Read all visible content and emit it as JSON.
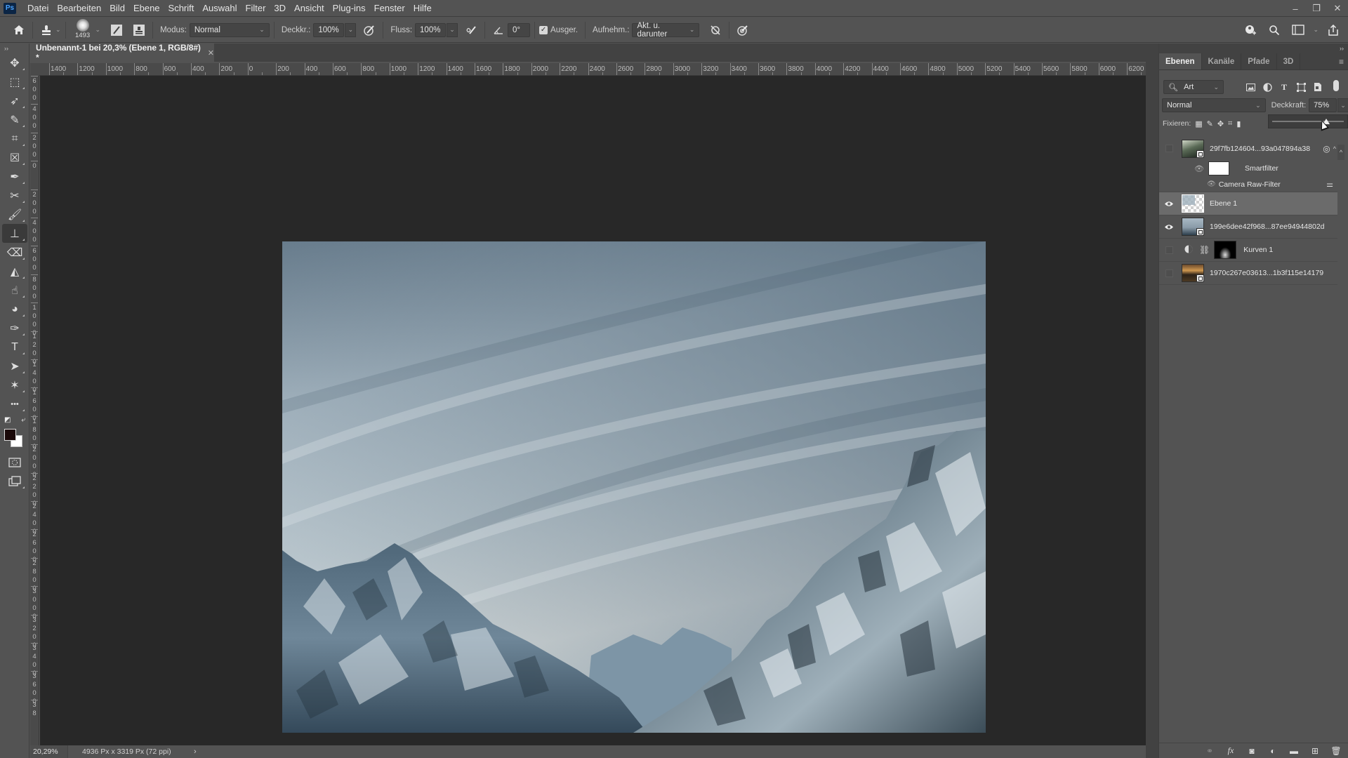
{
  "app": {
    "logo": "Ps",
    "name": "Adobe Photoshop"
  },
  "menu": [
    "Datei",
    "Bearbeiten",
    "Bild",
    "Ebene",
    "Schrift",
    "Auswahl",
    "Filter",
    "3D",
    "Ansicht",
    "Plug-ins",
    "Fenster",
    "Hilfe"
  ],
  "window_controls": {
    "minimize": "–",
    "restore": "❐",
    "close": "✕"
  },
  "options": {
    "brush_size": "1493",
    "mode_label": "Modus:",
    "mode_value": "Normal",
    "opacity_label": "Deckkr.:",
    "opacity_value": "100%",
    "flow_label": "Fluss:",
    "flow_value": "100%",
    "angle_value": "0°",
    "aligned_label": "Ausger.",
    "aligned_checked": true,
    "sample_label": "Aufnehm.:",
    "sample_value": "Akt. u. darunter"
  },
  "document": {
    "tab_title": "Unbenannt-1 bei 20,3% (Ebene 1, RGB/8#) *",
    "close": "✕"
  },
  "ruler": {
    "top_labels": [
      "1400",
      "1200",
      "1000",
      "800",
      "600",
      "400",
      "200",
      "0",
      "200",
      "400",
      "600",
      "800",
      "1000",
      "1200",
      "1400",
      "1600",
      "1800",
      "2000",
      "2200",
      "2400",
      "2600",
      "2800",
      "3000",
      "3200",
      "3400",
      "3600",
      "3800",
      "4000",
      "4200",
      "4400",
      "4600",
      "4800",
      "5000",
      "5200",
      "5400",
      "5600",
      "5800",
      "6000",
      "6200"
    ],
    "left_labels": [
      "600",
      "400",
      "200",
      "0",
      "200",
      "400",
      "600",
      "800",
      "1000",
      "1200",
      "1400",
      "1600",
      "1800",
      "2000",
      "2200",
      "2400",
      "2600",
      "2800",
      "3000",
      "3200",
      "3400",
      "3600",
      "38"
    ]
  },
  "status": {
    "zoom": "20,29%",
    "doc_size": "4936 Px x 3319 Px (72 ppi)",
    "arrow": "›"
  },
  "tools": [
    {
      "name": "move-tool",
      "glyph": "✥"
    },
    {
      "name": "marquee-tool",
      "glyph": "⬚"
    },
    {
      "name": "lasso-tool",
      "glyph": "➶"
    },
    {
      "name": "quick-selection-tool",
      "glyph": "✎"
    },
    {
      "name": "crop-tool",
      "glyph": "⌗"
    },
    {
      "name": "frame-tool",
      "glyph": "☒"
    },
    {
      "name": "eyedropper-tool",
      "glyph": "✒"
    },
    {
      "name": "healing-brush-tool",
      "glyph": "✂"
    },
    {
      "name": "brush-tool",
      "glyph": "🖌"
    },
    {
      "name": "clone-stamp-tool",
      "glyph": "⊥"
    },
    {
      "name": "eraser-tool",
      "glyph": "⌫"
    },
    {
      "name": "paint-bucket-tool",
      "glyph": "◭"
    },
    {
      "name": "smudge-tool",
      "glyph": "☝"
    },
    {
      "name": "dodge-tool",
      "glyph": "◕"
    },
    {
      "name": "pen-tool",
      "glyph": "✑"
    },
    {
      "name": "type-tool",
      "glyph": "T"
    },
    {
      "name": "path-selection-tool",
      "glyph": "➤"
    },
    {
      "name": "custom-shape-tool",
      "glyph": "✶"
    },
    {
      "name": "more-tools",
      "glyph": "•••"
    }
  ],
  "colors": {
    "foreground": "#1a0808",
    "background": "#ffffff"
  },
  "panel": {
    "tabs": [
      "Ebenen",
      "Kanäle",
      "Pfade",
      "3D"
    ],
    "active_tab": "Ebenen",
    "filter_label": "Art",
    "blend_mode": "Normal",
    "opacity_label": "Deckkraft:",
    "opacity_value": "75%",
    "opacity_slider_fraction": 0.75,
    "lock_label": "Fixieren:",
    "layers": [
      {
        "name": "29f7fb124604...93a047894a38",
        "visible": false,
        "type": "smart-object",
        "selected": false
      },
      {
        "name": "Smartfilter",
        "visible": true,
        "type": "smart-filter-mask"
      },
      {
        "name": "Camera Raw-Filter",
        "visible": true,
        "type": "filter"
      },
      {
        "name": "Ebene 1",
        "visible": true,
        "type": "pixel",
        "selected": true
      },
      {
        "name": "199e6dee42f968...87ee94944802d",
        "visible": true,
        "type": "smart-object",
        "selected": false
      },
      {
        "name": "Kurven 1",
        "visible": false,
        "type": "adjustment",
        "selected": false
      },
      {
        "name": "1970c267e03613...1b3f115e14179",
        "visible": false,
        "type": "smart-object",
        "selected": false
      }
    ]
  }
}
